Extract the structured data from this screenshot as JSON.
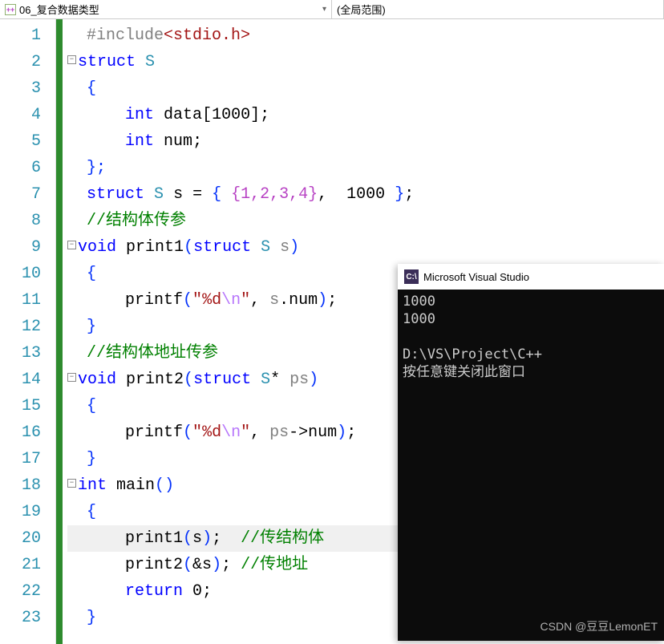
{
  "topbar": {
    "file_label": "06_复合数据类型",
    "scope_label": "(全局范围)"
  },
  "lines": [
    "1",
    "2",
    "3",
    "4",
    "5",
    "6",
    "7",
    "8",
    "9",
    "10",
    "11",
    "12",
    "13",
    "14",
    "15",
    "16",
    "17",
    "18",
    "19",
    "20",
    "21",
    "22",
    "23"
  ],
  "code": {
    "l1_include": "#include",
    "l1_header": "<stdio.h>",
    "kw_struct": "struct",
    "type_S": "S",
    "brace_open": "{",
    "brace_close": "}",
    "brace_close_semi": "};",
    "kw_int": "int",
    "id_data": "data",
    "arr_1000": "[1000];",
    "id_num": "num",
    "semi": ";",
    "id_s": "s",
    "eq": " = ",
    "init_open": "{ ",
    "init_inner": "{1,2,3,4}",
    "init_sep": ",  ",
    "init_1000": "1000",
    "init_close": " }",
    "comment1": "//结构体传参",
    "kw_void": "void",
    "id_print1": "print1",
    "id_print2": "print2",
    "id_printf": "printf",
    "param_s": "s",
    "param_ps": "ps",
    "star": "*",
    "fmt_open": "\"",
    "fmt_pct_d": "%d",
    "fmt_esc_n": "\\n",
    "fmt_close": "\"",
    "comma_sp": ", ",
    "dot": ".",
    "arrow": "->",
    "comment2": "//结构体地址传参",
    "kw_return": "return",
    "zero": "0",
    "kw_main": "main",
    "paren_open": "(",
    "paren_close": ")",
    "call_s": "s",
    "amp_s": "&s",
    "comment_body": "//传结构体",
    "comment_addr": "//传地址"
  },
  "console": {
    "title": "Microsoft Visual Studio",
    "out1": "1000",
    "out2": "1000",
    "path": "D:\\VS\\Project\\C++",
    "prompt": "按任意键关闭此窗口",
    "watermark": "CSDN @豆豆LemonET"
  }
}
